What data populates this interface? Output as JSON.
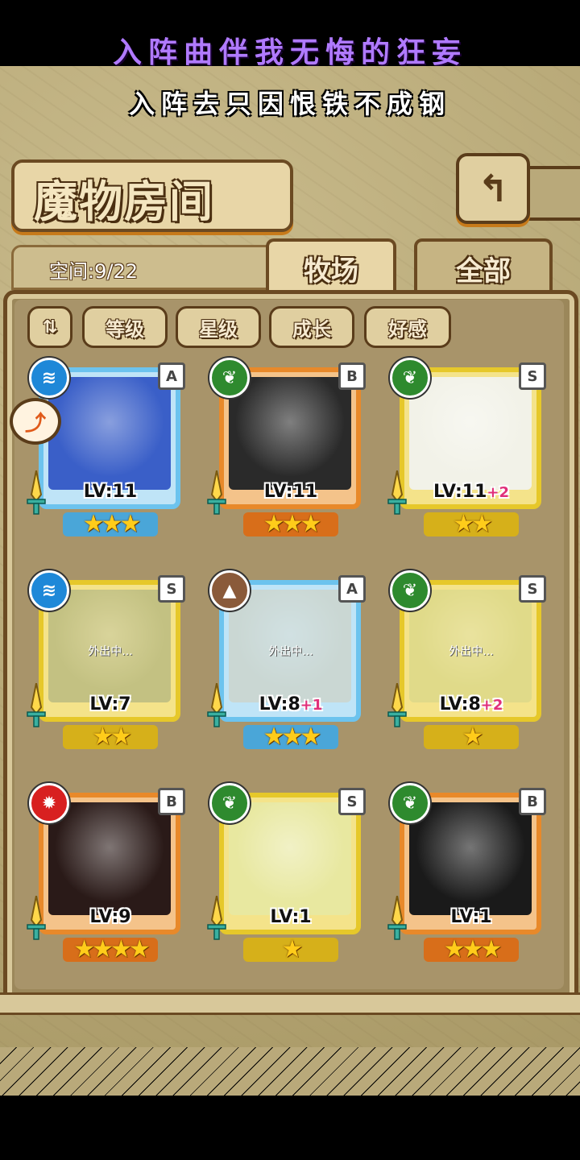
{
  "lyrics": {
    "line1": "入阵曲伴我无悔的狂妄",
    "line2": "入阵去只因恨铁不成钢"
  },
  "header": {
    "title": "魔物房间",
    "back_icon": "return-arrow-icon"
  },
  "space": {
    "label": "空间:9/22"
  },
  "tabs": [
    {
      "label": "牧场",
      "active": true
    },
    {
      "label": "全部",
      "active": false
    }
  ],
  "sort_buttons": [
    "等级",
    "星级",
    "成长",
    "好感"
  ],
  "cards": [
    {
      "rank": "A",
      "element": "water",
      "level": "LV:11",
      "plus": "",
      "stars": "★★★",
      "away_text": ""
    },
    {
      "rank": "B",
      "element": "wind",
      "level": "LV:11",
      "plus": "",
      "stars": "★★★",
      "away_text": ""
    },
    {
      "rank": "S",
      "element": "wind",
      "level": "LV:11",
      "plus": "+2",
      "stars": "★★",
      "away_text": ""
    },
    {
      "rank": "S",
      "element": "water",
      "level": "LV:7",
      "plus": "",
      "stars": "★★",
      "away_text": "外出中..."
    },
    {
      "rank": "A",
      "element": "earth",
      "level": "LV:8",
      "plus": "+1",
      "stars": "★★★",
      "away_text": "外出中..."
    },
    {
      "rank": "S",
      "element": "wind",
      "level": "LV:8",
      "plus": "+2",
      "stars": "★",
      "away_text": "外出中..."
    },
    {
      "rank": "B",
      "element": "fire",
      "level": "LV:9",
      "plus": "",
      "stars": "★★★★",
      "away_text": ""
    },
    {
      "rank": "S",
      "element": "wind",
      "level": "LV:1",
      "plus": "",
      "stars": "★",
      "away_text": ""
    },
    {
      "rank": "B",
      "element": "wind",
      "level": "LV:1",
      "plus": "",
      "stars": "★★★",
      "away_text": ""
    }
  ],
  "colors": {
    "lyric_purple": "#b07aff",
    "water": "#1e88d8",
    "wind": "#2e8a2e",
    "earth": "#8a5a3a",
    "fire": "#d82020"
  }
}
